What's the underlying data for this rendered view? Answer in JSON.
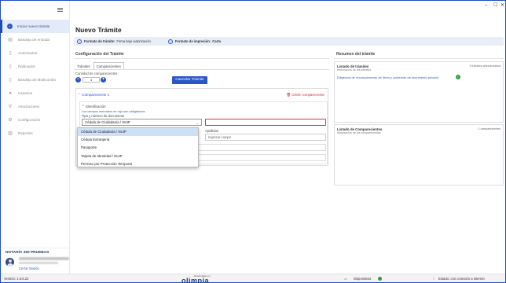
{
  "window": {
    "minimize": "–",
    "maximize": "☐",
    "close": "✕"
  },
  "sidebar": {
    "items": [
      {
        "label": "Iniciar nuevo trámite",
        "icon": "plus-circle-icon",
        "glyph": "+",
        "active": true
      },
      {
        "label": "Bandeja de entrada",
        "icon": "inbox-icon",
        "glyph": "▤"
      },
      {
        "label": "Autorizados",
        "icon": "document-icon",
        "glyph": "▯"
      },
      {
        "label": "Radicados",
        "icon": "document-icon",
        "glyph": "▯"
      },
      {
        "label": "Bandeja de Multicombo",
        "icon": "document-icon",
        "glyph": "▯"
      },
      {
        "label": "Usuarios",
        "icon": "user-icon",
        "glyph": "●"
      },
      {
        "label": "Asociaciones",
        "icon": "link-icon",
        "glyph": "⚲"
      },
      {
        "label": "Configuración",
        "icon": "gear-icon",
        "glyph": "⚙"
      },
      {
        "label": "Reportes",
        "icon": "chart-icon",
        "glyph": "▥"
      }
    ],
    "notary_title": "NOTARÍA 360 PRUEBAS",
    "logout": "Cerrar Sesión"
  },
  "main": {
    "title": "Nuevo Trámite",
    "info": {
      "format_label": "Formato de trámite:",
      "format_value": "Firma bajo autorización",
      "print_label": "Formato de impresión:",
      "print_value": "Carta"
    },
    "config_title": "Configuración del Trámite",
    "tabs": [
      "Trámites",
      "Comparecientes"
    ],
    "quantity_label": "Cantidad de comparecientes",
    "quantity_value": "1",
    "minus": "−",
    "plus": "+",
    "cancel_button": "Cancelar Trámite",
    "compareciente": {
      "title": "Compareciente 1",
      "omit": "Omitir compareciente",
      "identification_title": "Identificación",
      "required_note": "Los campos marcados en rojo son obligatorios",
      "doc_type_label": "Tipo y número de documento",
      "doc_type_value": "Cédula de Ciudadanía / NUIP",
      "surnames_label": "Apellidos",
      "surnames_placeholder": "Ingresar campo"
    },
    "dropdown_options": [
      "Cédula de Ciudadanía / NUIP",
      "Cédula Extranjería",
      "Pasaporte",
      "Tarjeta de Identidad / NUIP",
      "Permiso por Protección Temporal"
    ]
  },
  "summary": {
    "title": "Resumen del trámite",
    "tramites": {
      "title": "Listado de trámites",
      "subtitle": "Información de los trámites",
      "count": "1 trámites seleccionados",
      "item": "Diligencia de reconocimiento de firma y contenido de documento privado"
    },
    "comparecientes": {
      "title": "Listado de Comparecientes",
      "subtitle": "Información de los comparecientes",
      "count": "1 comparecientes"
    }
  },
  "statusbar": {
    "version": "Versión: 1.6.8.22",
    "brand_small": "Desarrollado por",
    "brand": "olimpia",
    "devices": "Dispositivos",
    "connection": "Estado: con conexión a internet"
  },
  "colors": {
    "accent": "#2a56c6",
    "required": "#dd3333",
    "success": "#2e9e3e"
  }
}
